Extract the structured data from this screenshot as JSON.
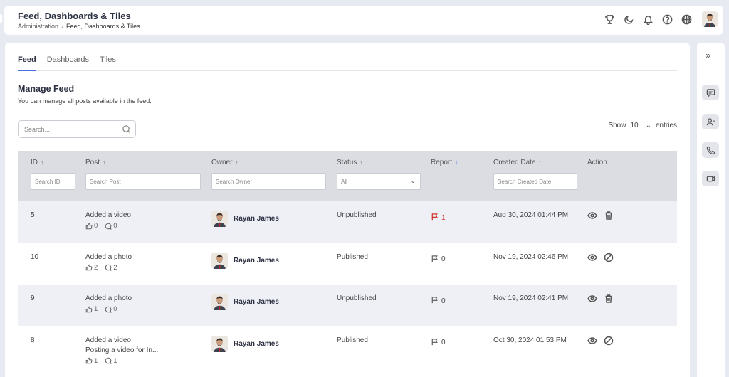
{
  "header": {
    "title": "Feed, Dashboards & Tiles",
    "breadcrumb": [
      "Administration",
      "Feed, Dashboards & Tiles"
    ]
  },
  "header_icons": [
    "trophy-icon",
    "moon-icon",
    "bell-icon",
    "help-icon",
    "globe-icon"
  ],
  "tabs": [
    {
      "label": "Feed",
      "active": true
    },
    {
      "label": "Dashboards",
      "active": false
    },
    {
      "label": "Tiles",
      "active": false
    }
  ],
  "section": {
    "title": "Manage Feed",
    "subtitle": "You can manage all posts available in the feed."
  },
  "search": {
    "placeholder": "Search..."
  },
  "entries": {
    "show_label": "Show",
    "value": "10",
    "suffix": "entries"
  },
  "table": {
    "columns": [
      {
        "label": "ID",
        "filter": "Search ID"
      },
      {
        "label": "Post",
        "filter": "Search Post"
      },
      {
        "label": "Owner",
        "filter": "Search Owner"
      },
      {
        "label": "Status",
        "filter": "All"
      },
      {
        "label": "Report",
        "filter": ""
      },
      {
        "label": "Created Date",
        "filter": "Search Created Date"
      },
      {
        "label": "Action",
        "filter": ""
      }
    ],
    "rows": [
      {
        "id": "5",
        "post": "Added a video",
        "post_extra": "",
        "likes": "0",
        "comments": "0",
        "owner": "Rayan James",
        "status": "Unpublished",
        "report": "1",
        "reported": true,
        "created": "Aug 30, 2024 01:44 PM",
        "second_action": "delete"
      },
      {
        "id": "10",
        "post": "Added a photo",
        "post_extra": "",
        "likes": "2",
        "comments": "2",
        "owner": "Rayan James",
        "status": "Published",
        "report": "0",
        "reported": false,
        "created": "Nov 19, 2024 02:46 PM",
        "second_action": "block"
      },
      {
        "id": "9",
        "post": "Added a photo",
        "post_extra": "",
        "likes": "1",
        "comments": "0",
        "owner": "Rayan James",
        "status": "Unpublished",
        "report": "0",
        "reported": false,
        "created": "Nov 19, 2024 02:41 PM",
        "second_action": "delete"
      },
      {
        "id": "8",
        "post": "Added a video",
        "post_extra": "Posting a video for In...",
        "likes": "1",
        "comments": "1",
        "owner": "Rayan James",
        "status": "Published",
        "report": "0",
        "reported": false,
        "created": "Oct 30, 2024 01:53 PM",
        "second_action": "block"
      }
    ]
  },
  "colors": {
    "accent": "#4a6ee0",
    "report_flag": "#d0342c",
    "header_bg": "#dcdde3",
    "row_alt": "#eef0f6"
  }
}
